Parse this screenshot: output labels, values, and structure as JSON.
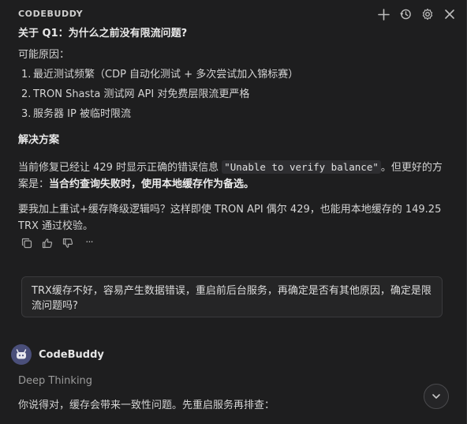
{
  "app": {
    "title": "CODEBUDDY"
  },
  "header_icons": [
    "plus-icon",
    "history-icon",
    "gear-icon",
    "close-icon"
  ],
  "answer": {
    "question_title": "关于 Q1：为什么之前没有限流问题?",
    "causes_label": "可能原因：",
    "causes": [
      {
        "num": "1.",
        "text": "最近测试频繁（CDP 自动化测试 + 多次尝试加入锦标赛）"
      },
      {
        "num": "2.",
        "text": "TRON Shasta 测试网 API 对免费层限流更严格"
      },
      {
        "num": "3.",
        "text": "服务器 IP 被临时限流"
      }
    ],
    "solution_title": "解决方案",
    "solution_p1_a": "当前修复已经让 429 时显示正确的错误信息 ",
    "solution_p1_code": "\"Unable to verify balance\"",
    "solution_p1_b": "。但更好的方案是：",
    "solution_p1_bold": "当合约查询失败时，使用本地缓存作为备选。",
    "solution_p2": "要我加上重试+缓存降级逻辑吗？这样即使 TRON API 偶尔 429，也能用本地缓存的 149.25 TRX 通过校验。"
  },
  "feedback_icons": [
    "copy-icon",
    "thumbs-up-icon",
    "thumbs-down-icon",
    "more-icon"
  ],
  "more_label": "···",
  "user_message": "TRX缓存不好，容易产生数据错误，重启前后台服务，再确定是否有其他原因，确定是限流问题吗?",
  "bot": {
    "name": "CodeBuddy",
    "status": "Deep Thinking",
    "reply": "你说得对，缓存会带来一致性问题。先重启服务再排查："
  },
  "colors": {
    "background": "#1e1e1f",
    "text": "#d4d4d4",
    "muted": "#9a9a9a",
    "avatar": "#4a4f7a",
    "card_border": "#3a3a3c"
  }
}
